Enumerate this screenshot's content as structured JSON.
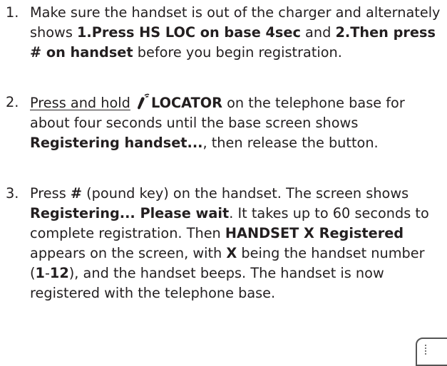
{
  "steps": [
    {
      "number": "1.",
      "t1": "Make sure the handset is out of the charger and alternately shows ",
      "b1": "1.Press HS LOC on base 4sec",
      "t2": " and ",
      "b2": "2.Then press # on handset",
      "t3": " before you begin registration."
    },
    {
      "number": "2.",
      "u1": "Press and hold",
      "icon": "locator-handset-icon",
      "b1": "LOCATOR",
      "t1": " on the telephone base for about four seconds until the base screen shows ",
      "b2": "Registering handset...",
      "t2": ", then release the button."
    },
    {
      "number": "3.",
      "t1": "Press ",
      "b1": "#",
      "t2": " (pound key) on the handset. The screen shows ",
      "b2": "Registering... Please wait",
      "t3": ". It takes up to 60 seconds to complete registration. Then ",
      "b3": "HANDSET X Registered",
      "t4": " appears on the screen, with ",
      "b4": "X",
      "t5": " being the handset number (",
      "b5": "1",
      "t6": "-",
      "b6": "12",
      "t7": "), and the handset beeps. The handset is now registered with the telephone base."
    }
  ]
}
